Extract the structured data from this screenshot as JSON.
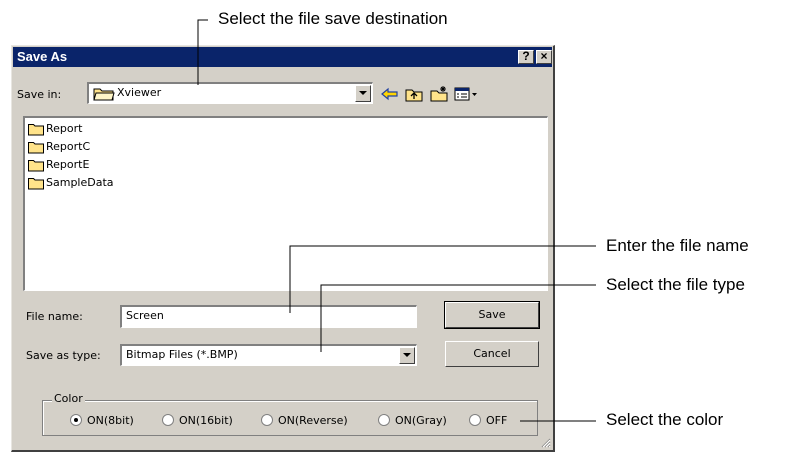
{
  "dialog": {
    "title": "Save As",
    "help_button": "?",
    "close_button": "×",
    "save_in_label": "Save in:",
    "save_in_value": "Xviewer",
    "toolbar": [
      "back-icon",
      "up-folder-icon",
      "new-folder-icon",
      "view-menu-icon"
    ],
    "files": [
      "Report",
      "ReportC",
      "ReportE",
      "SampleData"
    ],
    "file_name_label": "File name:",
    "file_name_value": "Screen",
    "save_as_type_label": "Save as type:",
    "save_as_type_value": "Bitmap Files (*.BMP)",
    "save_button": "Save",
    "cancel_button": "Cancel",
    "color_group_label": "Color",
    "color_options": [
      "ON(8bit)",
      "ON(16bit)",
      "ON(Reverse)",
      "ON(Gray)",
      "OFF"
    ],
    "color_selected": "ON(8bit)"
  },
  "callouts": {
    "save_destination": "Select the file save destination",
    "file_name": "Enter the file name",
    "file_type": "Select the file type",
    "color": "Select the color"
  },
  "colors": {
    "titlebar": "#0a246a",
    "dialog_face": "#d4d0c8",
    "folder": "#ffe38a"
  }
}
